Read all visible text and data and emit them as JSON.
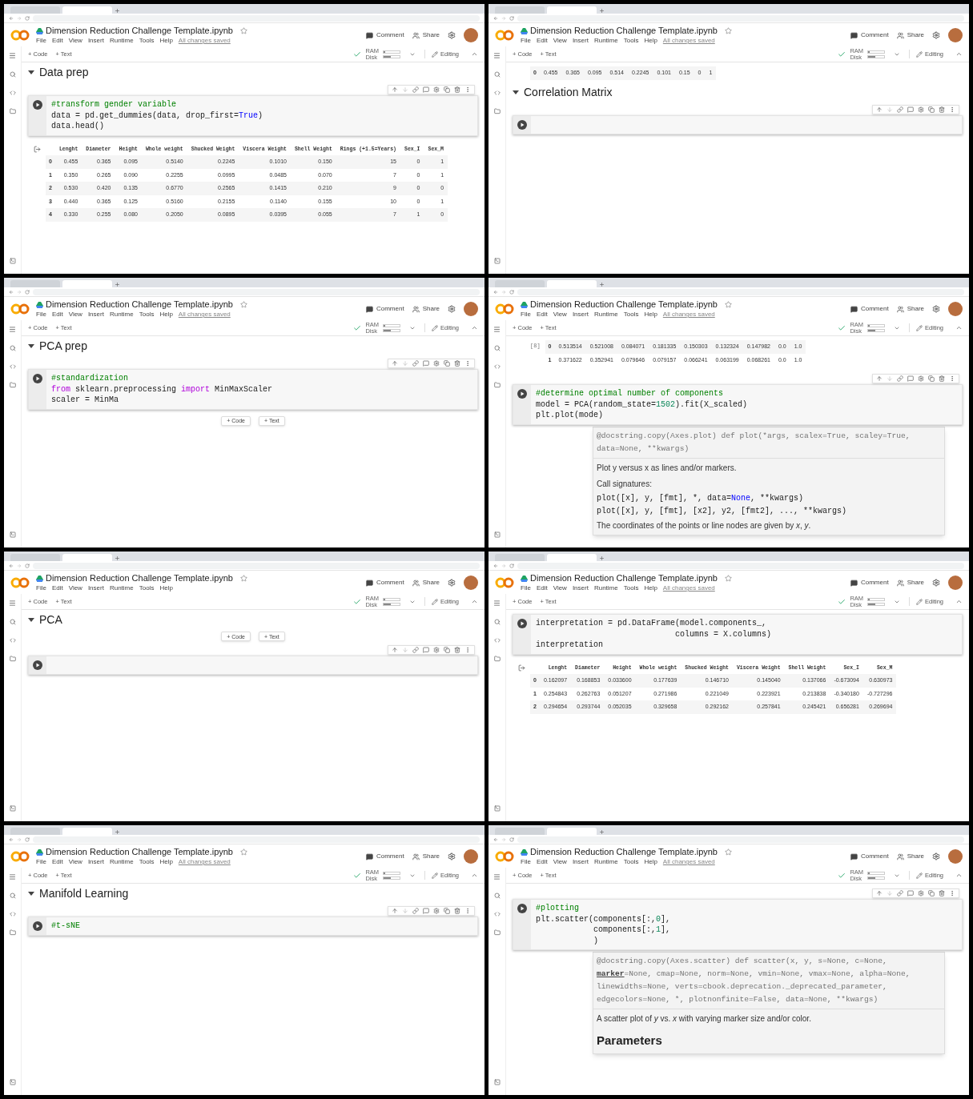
{
  "panels": [
    {
      "title": "Dimension Reduction Challenge Template.ipynb",
      "menu": [
        "File",
        "Edit",
        "View",
        "Insert",
        "Runtime",
        "Tools",
        "Help"
      ],
      "save_status": "All changes saved",
      "comment": "Comment",
      "share": "Share",
      "add_code": "+ Code",
      "add_text": "+ Text",
      "ram": "RAM",
      "disk": "Disk",
      "mode": "Editing",
      "blocks": [
        {
          "kind": "section",
          "title": "Data prep",
          "expanded": true
        },
        {
          "kind": "code",
          "toolbar": true,
          "lines": [
            [
              {
                "text": "#transform gender variable",
                "kind": "comment"
              }
            ],
            [
              {
                "text": "data = pd.get_dummies(data, drop_first=",
                "kind": "plain"
              },
              {
                "text": "True",
                "kind": "constant"
              },
              {
                "text": ")",
                "kind": "plain"
              }
            ],
            "data.head()"
          ]
        },
        {
          "kind": "table",
          "columns": [
            "Lenght",
            "Diameter",
            "Height",
            "Whole weight",
            "Shucked Weight",
            "Viscera Weight",
            "Shell Weight",
            "Rings (+1.5=Years)",
            "Sex_I",
            "Sex_M"
          ],
          "rows": [
            {
              "index": "0",
              "cells": [
                "0.455",
                "0.365",
                "0.095",
                "0.5140",
                "0.2245",
                "0.1010",
                "0.150",
                "15",
                "0",
                "1"
              ]
            },
            {
              "index": "1",
              "cells": [
                "0.350",
                "0.265",
                "0.090",
                "0.2255",
                "0.0995",
                "0.0485",
                "0.070",
                "7",
                "0",
                "1"
              ]
            },
            {
              "index": "2",
              "cells": [
                "0.530",
                "0.420",
                "0.135",
                "0.6770",
                "0.2565",
                "0.1415",
                "0.210",
                "9",
                "0",
                "0"
              ]
            },
            {
              "index": "3",
              "cells": [
                "0.440",
                "0.365",
                "0.125",
                "0.5160",
                "0.2155",
                "0.1140",
                "0.155",
                "10",
                "0",
                "1"
              ]
            },
            {
              "index": "4",
              "cells": [
                "0.330",
                "0.255",
                "0.080",
                "0.2050",
                "0.0895",
                "0.0395",
                "0.055",
                "7",
                "1",
                "0"
              ]
            }
          ]
        }
      ]
    },
    {
      "title": "Dimension Reduction Challenge Template.ipynb",
      "menu": [
        "File",
        "Edit",
        "View",
        "Insert",
        "Runtime",
        "Tools",
        "Help"
      ],
      "save_status": "All changes saved",
      "comment": "Comment",
      "share": "Share",
      "add_code": "+ Code",
      "add_text": "+ Text",
      "ram": "RAM",
      "disk": "Disk",
      "mode": "Editing",
      "blocks": [
        {
          "kind": "table",
          "rows": [
            {
              "index": "0",
              "cells": [
                "0.455",
                "0.365",
                "0.095",
                "0.514",
                "0.2245",
                "0.101",
                "0.15",
                "0",
                "1"
              ]
            }
          ]
        },
        {
          "kind": "section",
          "title": "Correlation Matrix",
          "expanded": true
        },
        {
          "kind": "code",
          "toolbar": true
        }
      ]
    },
    {
      "title": "Dimension Reduction Challenge Template.ipynb",
      "menu": [
        "File",
        "Edit",
        "View",
        "Insert",
        "Runtime",
        "Tools",
        "Help"
      ],
      "save_status": "All changes saved",
      "comment": "Comment",
      "share": "Share",
      "add_code": "+ Code",
      "add_text": "+ Text",
      "ram": "RAM",
      "disk": "Disk",
      "mode": "Editing",
      "blocks": [
        {
          "kind": "section",
          "title": "PCA prep",
          "expanded": true
        },
        {
          "kind": "code",
          "toolbar": true,
          "lines": [
            [
              {
                "text": "#standardization",
                "kind": "comment"
              }
            ],
            [
              {
                "text": "from",
                "kind": "keyword"
              },
              {
                "text": " sklearn.preprocessing ",
                "kind": "plain"
              },
              {
                "text": "import",
                "kind": "keyword"
              },
              {
                "text": " MinMaxScaler",
                "kind": "plain"
              }
            ],
            "scaler = MinMa"
          ]
        },
        {
          "kind": "insert",
          "buttons": [
            "+ Code",
            "+ Text"
          ]
        }
      ]
    },
    {
      "title": "Dimension Reduction Challenge Template.ipynb",
      "menu": [
        "File",
        "Edit",
        "View",
        "Insert",
        "Runtime",
        "Tools",
        "Help"
      ],
      "save_status": "All changes saved",
      "comment": "Comment",
      "share": "Share",
      "add_code": "+ Code",
      "add_text": "+ Text",
      "ram": "RAM",
      "disk": "Disk",
      "mode": "Editing",
      "blocks": [
        {
          "kind": "table",
          "label": "[8]",
          "rows": [
            {
              "index": "0",
              "cells": [
                "0.513514",
                "0.521008",
                "0.084071",
                "0.181335",
                "0.150303",
                "0.132324",
                "0.147982",
                "0.0",
                "1.0"
              ]
            },
            {
              "index": "1",
              "cells": [
                "0.371622",
                "0.352941",
                "0.079646",
                "0.079157",
                "0.066241",
                "0.063199",
                "0.068261",
                "0.0",
                "1.0"
              ]
            }
          ]
        },
        {
          "kind": "code",
          "toolbar": true,
          "lines": [
            [
              {
                "text": "#determine optimal number of components",
                "kind": "comment"
              }
            ],
            [
              {
                "text": "model = PCA(random_state=",
                "kind": "plain"
              },
              {
                "text": "1502",
                "kind": "number"
              },
              {
                "text": ").fit(X_scaled)",
                "kind": "plain"
              }
            ],
            "plt.plot(mode)"
          ]
        },
        {
          "kind": "tooltip",
          "signature": [
            "@docstring.copy(Axes.plot) def plot(*args, scalex=True, scaley=True,",
            "data=None, **kwargs)"
          ],
          "body": [
            {
              "kind": "text",
              "text": "Plot y versus x as lines and/or markers."
            },
            {
              "kind": "text",
              "text": "Call signatures:"
            },
            {
              "kind": "code",
              "line": [
                {
                  "text": "plot([x], y, [fmt], *, data=",
                  "kind": "plain"
                },
                {
                  "text": "None",
                  "kind": "constant"
                },
                {
                  "text": ", **kwargs)",
                  "kind": "plain"
                }
              ]
            },
            {
              "kind": "code",
              "line": "plot([x], y, [fmt], [x2], y2, [fmt2], ..., **kwargs)"
            },
            {
              "kind": "text",
              "text": "The coordinates of the points or line nodes are given by *x*, *y*."
            }
          ]
        }
      ]
    },
    {
      "title": "Dimension Reduction Challenge Template.ipynb",
      "menu": [
        "File",
        "Edit",
        "View",
        "Insert",
        "Runtime",
        "Tools",
        "Help"
      ],
      "comment": "Comment",
      "share": "Share",
      "add_code": "+ Code",
      "add_text": "+ Text",
      "ram": "RAM",
      "disk": "Disk",
      "mode": "Editing",
      "blocks": [
        {
          "kind": "section",
          "title": "PCA",
          "expanded": true
        },
        {
          "kind": "insert",
          "buttons": [
            "+ Code",
            "+ Text"
          ]
        },
        {
          "kind": "code",
          "toolbar": true
        }
      ]
    },
    {
      "title": "Dimension Reduction Challenge Template.ipynb",
      "menu": [
        "File",
        "Edit",
        "View",
        "Insert",
        "Runtime",
        "Tools",
        "Help"
      ],
      "save_status": "All changes saved",
      "comment": "Comment",
      "share": "Share",
      "add_code": "+ Code",
      "add_text": "+ Text",
      "ram": "RAM",
      "disk": "Disk",
      "mode": "Editing",
      "blocks": [
        {
          "kind": "code",
          "toolbar": false,
          "lines": [
            "interpretation = pd.DataFrame(model.components_,",
            "                             columns = X.columns)",
            "interpretation"
          ]
        },
        {
          "kind": "table",
          "columns": [
            "Lenght",
            "Diameter",
            "Height",
            "Whole weight",
            "Shucked Weight",
            "Viscera Weight",
            "Shell Weight",
            "Sex_I",
            "Sex_M"
          ],
          "rows": [
            {
              "index": "0",
              "cells": [
                "0.162097",
                "0.168853",
                "0.033600",
                "0.177639",
                "0.146710",
                "0.145040",
                "0.137066",
                "-0.673094",
                "0.630973"
              ]
            },
            {
              "index": "1",
              "cells": [
                "0.254843",
                "0.262763",
                "0.051207",
                "0.271986",
                "0.221049",
                "0.223921",
                "0.213838",
                "-0.340180",
                "-0.727296"
              ]
            },
            {
              "index": "2",
              "cells": [
                "0.294654",
                "0.293744",
                "0.052035",
                "0.329658",
                "0.292162",
                "0.257841",
                "0.245421",
                "0.656281",
                "0.269694"
              ]
            }
          ]
        }
      ]
    },
    {
      "title": "Dimension Reduction Challenge Template.ipynb",
      "menu": [
        "File",
        "Edit",
        "View",
        "Insert",
        "Runtime",
        "Tools",
        "Help"
      ],
      "save_status": "All changes saved",
      "comment": "Comment",
      "share": "Share",
      "add_code": "+ Code",
      "add_text": "+ Text",
      "ram": "RAM",
      "disk": "Disk",
      "mode": "Editing",
      "blocks": [
        {
          "kind": "section",
          "title": "Manifold Learning",
          "expanded": true
        },
        {
          "kind": "code",
          "toolbar": true,
          "lines": [
            [
              {
                "text": "#t-sNE",
                "kind": "comment"
              }
            ]
          ]
        }
      ]
    },
    {
      "title": "Dimension Reduction Challenge Template.ipynb",
      "menu": [
        "File",
        "Edit",
        "View",
        "Insert",
        "Runtime",
        "Tools",
        "Help"
      ],
      "save_status": "All changes saved",
      "comment": "Comment",
      "share": "Share",
      "add_code": "+ Code",
      "add_text": "+ Text",
      "ram": "RAM",
      "disk": "Disk",
      "mode": "Editing",
      "blocks": [
        {
          "kind": "code",
          "toolbar": true,
          "lines": [
            [
              {
                "text": "#plotting",
                "kind": "comment"
              }
            ],
            [
              {
                "text": "plt.scatter(components[:,",
                "kind": "plain"
              },
              {
                "text": "0",
                "kind": "number"
              },
              {
                "text": "],",
                "kind": "plain"
              }
            ],
            [
              {
                "text": "            components[:,",
                "kind": "plain"
              },
              {
                "text": "1",
                "kind": "number"
              },
              {
                "text": "],",
                "kind": "plain"
              }
            ],
            "            )"
          ]
        },
        {
          "kind": "tooltip",
          "signature": [
            "@docstring.copy(Axes.scatter) def scatter(x, y, s=None, c=None,",
            [
              {
                "text": "marker",
                "kind": "param"
              },
              {
                "text": "=None, cmap=None, norm=None, vmin=None, vmax=None, alpha=None,",
                "kind": "doc"
              }
            ],
            "linewidths=None, verts=cbook.deprecation._deprecated_parameter,",
            "edgecolors=None, *, plotnonfinite=False, data=None, **kwargs)"
          ],
          "body": [
            {
              "kind": "text",
              "text": "A scatter plot of *y* vs. *x* with varying marker size and/or color."
            },
            {
              "kind": "heading",
              "text": "Parameters"
            }
          ]
        }
      ]
    }
  ]
}
